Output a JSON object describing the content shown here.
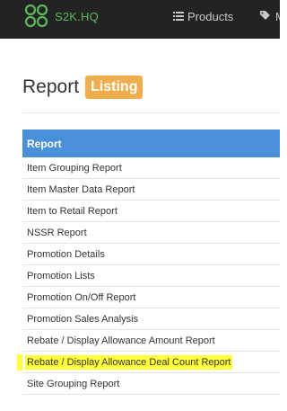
{
  "navbar": {
    "brand": "S2K.HQ",
    "items": [
      {
        "label": "Products",
        "icon": "list-icon"
      },
      {
        "label": "M",
        "icon": "tags-icon"
      }
    ]
  },
  "page": {
    "title": "Report",
    "badge": "Listing"
  },
  "table": {
    "header": "Report",
    "rows": [
      "Item Grouping Report",
      "Item Master Data Report",
      "Item to Retail Report",
      "NSSR Report",
      "Promotion Details",
      "Promotion Lists",
      "Promotion On/Off Report",
      "Promotion Sales Analysis",
      "Rebate / Display Allowance Amount Report",
      "Rebate / Display Allowance Deal Count Report",
      "Site Grouping Report"
    ],
    "highlighted_row_index": 9
  },
  "colors": {
    "navbar_bg": "#232323",
    "brand": "#5cb85c",
    "badge": "#f0ad4e",
    "table_header": "#4a90d9",
    "highlight": "#ffff3a"
  }
}
